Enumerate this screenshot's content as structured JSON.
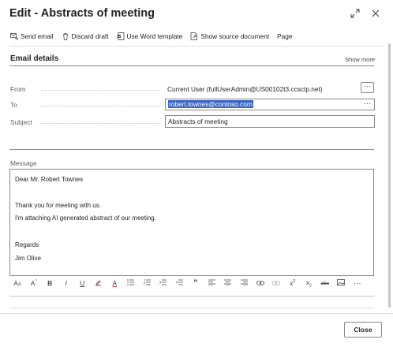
{
  "window": {
    "title": "Edit - Abstracts of meeting"
  },
  "toolbar": {
    "send": "Send email",
    "discard": "Discard draft",
    "template": "Use Word template",
    "source": "Show source document",
    "page": "Page"
  },
  "section": {
    "title": "Email details",
    "show_more": "Show more"
  },
  "from": {
    "label": "From",
    "value": "Current User (fullUserAdmin@US00102t3.ccsctp.net)",
    "more": "···"
  },
  "to": {
    "label": "To",
    "value": "robert.townes@contoso.com",
    "more": "···"
  },
  "subject": {
    "label": "Subject",
    "value": "Abstracts of meeting"
  },
  "message": {
    "label": "Message",
    "lines": [
      "Dear Mr. Robert Townes",
      "Thank you for meeting with us.",
      "I'm attaching AI generated abstract of our meeting.",
      "Regards",
      "Jim Olive"
    ]
  },
  "format": {
    "font_size": "A",
    "grow": "A",
    "bold": "B",
    "italic": "I",
    "underline": "U",
    "font_color": "A",
    "quote": "”",
    "superscript": "x",
    "subscript": "x",
    "strike": "abc",
    "more": "···"
  },
  "footer": {
    "close": "Close"
  }
}
